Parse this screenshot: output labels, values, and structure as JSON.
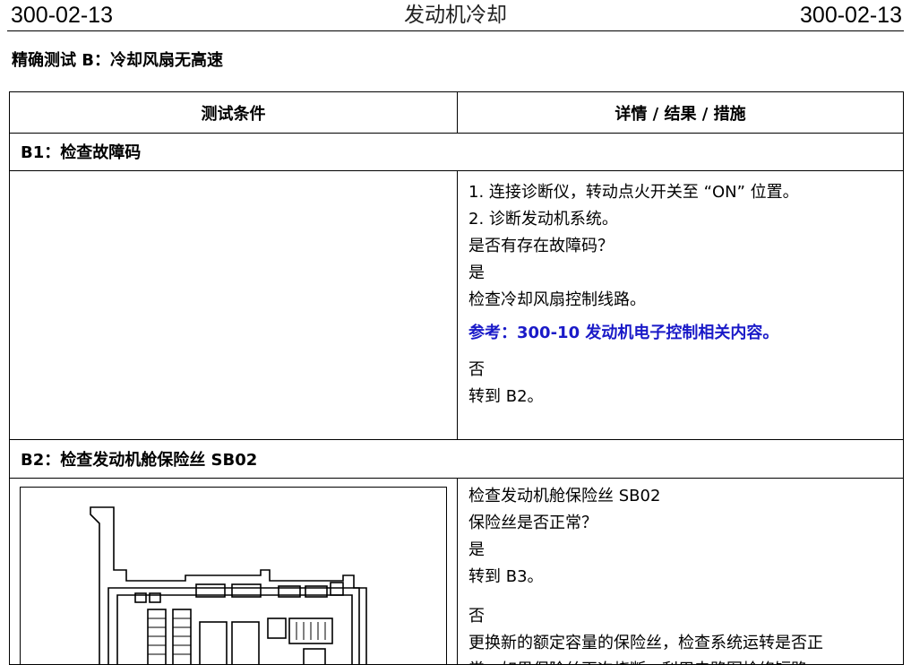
{
  "header": {
    "page_left": "300-02-13",
    "title": "发动机冷却",
    "page_right": "300-02-13"
  },
  "section_title": "精确测试 B：冷却风扇无高速",
  "table": {
    "col_condition": "测试条件",
    "col_details": "详情 / 结果 / 措施",
    "steps": [
      {
        "title": "B1：检查故障码",
        "lines": [
          "1. 连接诊断仪，转动点火开关至 “ON” 位置。",
          "2. 诊断发动机系统。",
          "是否有存在故障码？",
          "是",
          "检查冷却风扇控制线路。",
          "参考：300-10 发动机电子控制相关内容。",
          "否",
          "转到 B2。"
        ]
      },
      {
        "title": "B2：检查发动机舱保险丝 SB02",
        "lines": [
          "检查发动机舱保险丝 SB02",
          "保险丝是否正常？",
          "是",
          "转到 B3。",
          "否",
          "更换新的额定容量的保险丝，检查系统运转是否正",
          "常。如果保险丝再次烧断，利用电路图检修短路"
        ]
      }
    ]
  },
  "colors": {
    "reference_text": "#1a1ac8"
  }
}
